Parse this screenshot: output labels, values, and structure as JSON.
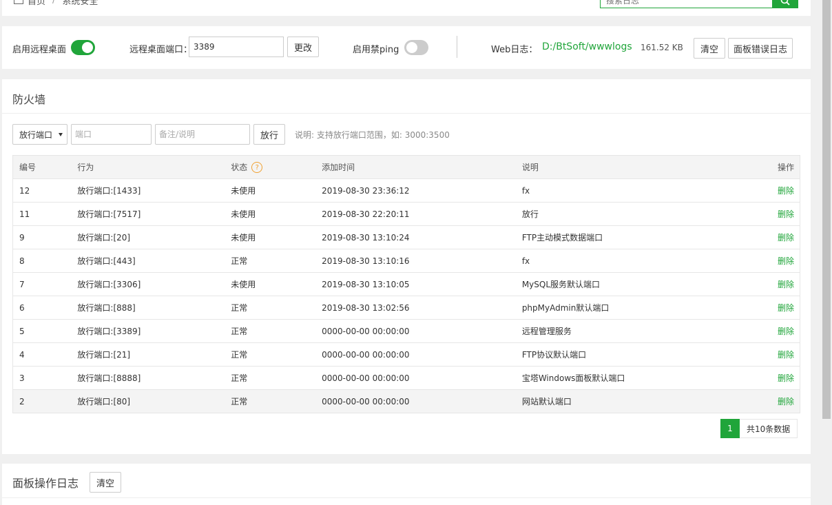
{
  "header": {
    "breadcrumb_home": "首页",
    "breadcrumb_sep": "/",
    "breadcrumb_current": "系统安全",
    "search_placeholder": "搜索日志"
  },
  "settings": {
    "remote_desktop_label": "启用远程桌面",
    "remote_desktop_enabled": true,
    "port_label": "远程桌面端口：",
    "port_value": "3389",
    "change_button": "更改",
    "ping_label": "启用禁ping",
    "ping_enabled": false,
    "web_log_label": "Web日志：",
    "web_log_path": "D:/BtSoft/wwwlogs",
    "web_log_size": "161.52 KB",
    "clear_button": "清空",
    "panel_error_log_button": "面板错误日志"
  },
  "firewall": {
    "title": "防火墙",
    "select_value": "放行端口",
    "port_placeholder": "端口",
    "note_placeholder": "备注/说明",
    "allow_button": "放行",
    "hint": "说明: 支持放行端口范围，如: 3000:3500",
    "columns": [
      "编号",
      "行为",
      "状态",
      "添加时间",
      "说明",
      "操作"
    ],
    "rows": [
      {
        "id": "12",
        "action": "放行端口:[1433]",
        "status": "未使用",
        "time": "2019-08-30 23:36:12",
        "desc": "fx",
        "op": "删除"
      },
      {
        "id": "11",
        "action": "放行端口:[7517]",
        "status": "未使用",
        "time": "2019-08-30 22:20:11",
        "desc": "放行",
        "op": "删除"
      },
      {
        "id": "9",
        "action": "放行端口:[20]",
        "status": "未使用",
        "time": "2019-08-30 13:10:24",
        "desc": "FTP主动模式数据端口",
        "op": "删除"
      },
      {
        "id": "8",
        "action": "放行端口:[443]",
        "status": "正常",
        "time": "2019-08-30 13:10:16",
        "desc": "fx",
        "op": "删除"
      },
      {
        "id": "7",
        "action": "放行端口:[3306]",
        "status": "未使用",
        "time": "2019-08-30 13:10:05",
        "desc": "MySQL服务默认端口",
        "op": "删除"
      },
      {
        "id": "6",
        "action": "放行端口:[888]",
        "status": "正常",
        "time": "2019-08-30 13:02:56",
        "desc": "phpMyAdmin默认端口",
        "op": "删除"
      },
      {
        "id": "5",
        "action": "放行端口:[3389]",
        "status": "正常",
        "time": "0000-00-00 00:00:00",
        "desc": "远程管理服务",
        "op": "删除"
      },
      {
        "id": "4",
        "action": "放行端口:[21]",
        "status": "正常",
        "time": "0000-00-00 00:00:00",
        "desc": "FTP协议默认端口",
        "op": "删除"
      },
      {
        "id": "3",
        "action": "放行端口:[8888]",
        "status": "正常",
        "time": "0000-00-00 00:00:00",
        "desc": "宝塔Windows面板默认端口",
        "op": "删除"
      },
      {
        "id": "2",
        "action": "放行端口:[80]",
        "status": "正常",
        "time": "0000-00-00 00:00:00",
        "desc": "网站默认端口",
        "op": "删除"
      }
    ],
    "pagination": {
      "current_page": "1",
      "total": "共10条数据"
    }
  },
  "op_log": {
    "title": "面板操作日志",
    "clear_button": "清空"
  },
  "colors": {
    "accent": "#20a53a",
    "warning": "#f0a030"
  }
}
